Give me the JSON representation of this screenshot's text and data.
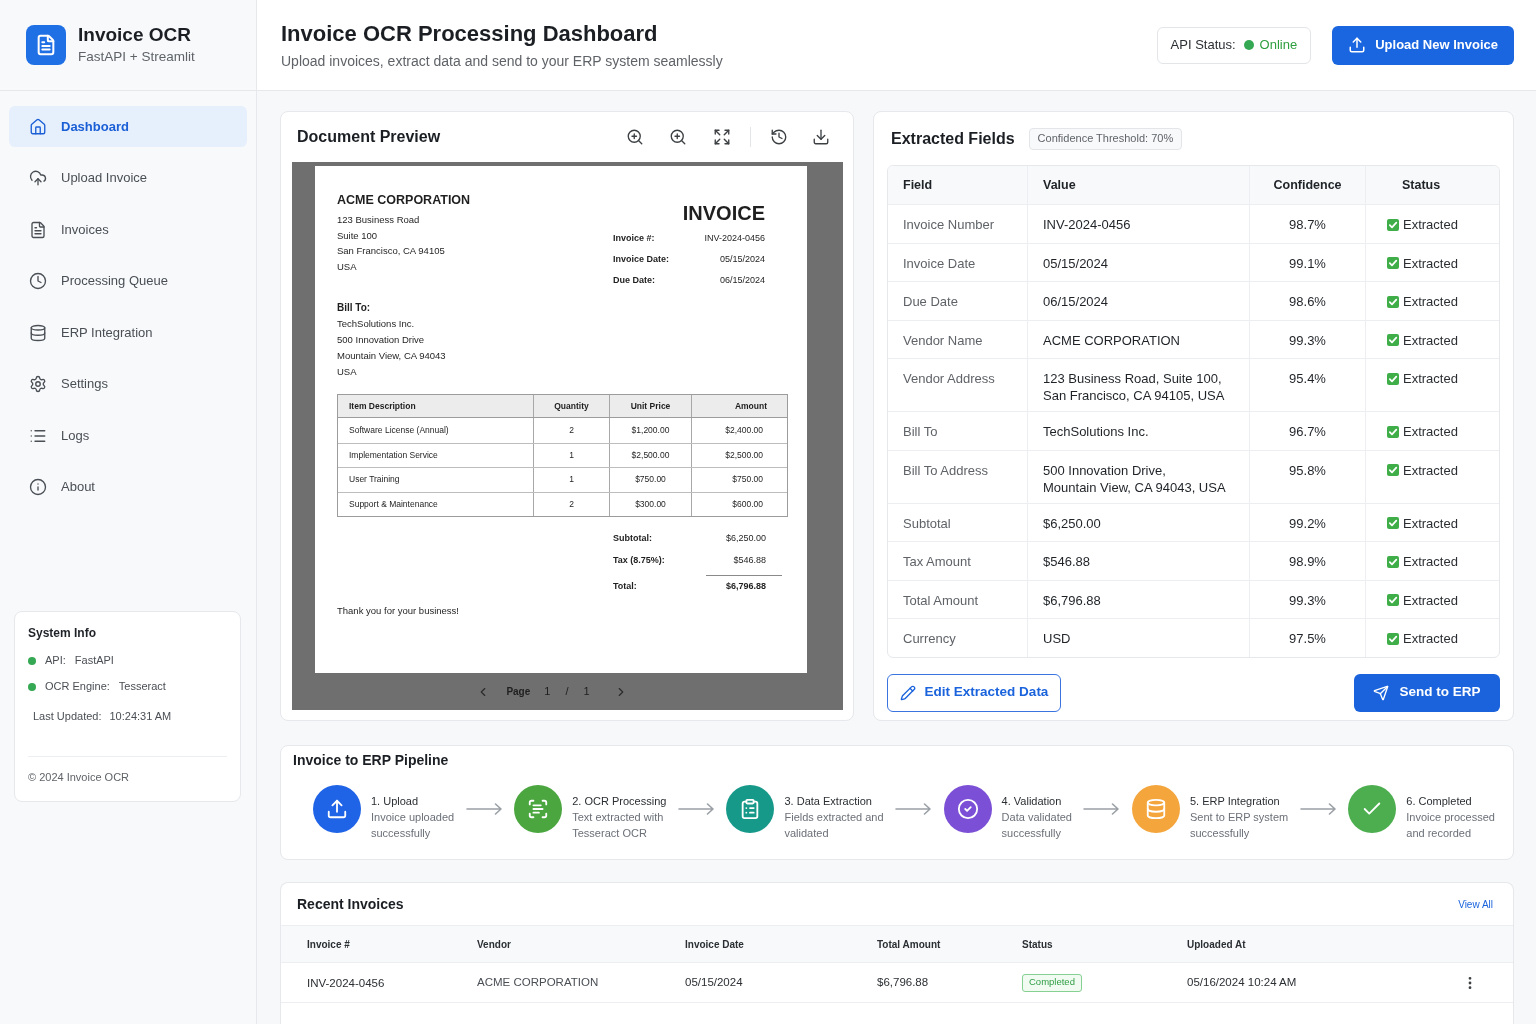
{
  "brand": {
    "title": "Invoice OCR",
    "subtitle": "FastAPI + Streamlit"
  },
  "sidebar": {
    "items": [
      {
        "label": "Dashboard",
        "selected": true
      },
      {
        "label": "Upload Invoice",
        "selected": false
      },
      {
        "label": "Invoices",
        "selected": false
      },
      {
        "label": "Processing Queue",
        "selected": false
      },
      {
        "label": "ERP Integration",
        "selected": false
      },
      {
        "label": "Settings",
        "selected": false
      },
      {
        "label": "Logs",
        "selected": false
      },
      {
        "label": "About",
        "selected": false
      }
    ],
    "system_info": {
      "title": "System Info",
      "items": [
        {
          "label": "API:",
          "value": "FastAPI",
          "online": true
        },
        {
          "label": "OCR Engine:",
          "value": "Tesseract",
          "online": true
        }
      ],
      "last_updated": {
        "label": "Last Updated:",
        "value": "10:24:31 AM"
      },
      "footer": "© 2024 Invoice OCR"
    }
  },
  "header": {
    "title": "Invoice OCR Processing Dashboard",
    "subtitle": "Upload invoices, extract data and send to your ERP system seamlessly",
    "api_status": {
      "label": "API Status:",
      "value": "Online",
      "online": true
    },
    "upload_button": "Upload New Invoice"
  },
  "document_preview": {
    "title": "Document Preview",
    "page": {
      "vendor": {
        "name": "ACME CORPORATION",
        "address": [
          "123 Business Road",
          "Suite 100",
          "San Francisco, CA 94105",
          "USA"
        ]
      },
      "heading": "INVOICE",
      "meta": [
        {
          "label": "Invoice #:",
          "value": "INV-2024-0456"
        },
        {
          "label": "Invoice Date:",
          "value": "05/15/2024"
        },
        {
          "label": "Due Date:",
          "value": "06/15/2024"
        }
      ],
      "bill_to": {
        "label": "Bill To:",
        "lines": [
          "TechSolutions Inc.",
          "500 Innovation Drive",
          "Mountain View, CA 94043",
          "USA"
        ]
      },
      "items_table": {
        "columns": [
          "Item Description",
          "Quantity",
          "Unit Price",
          "Amount"
        ],
        "rows": [
          [
            "Software License (Annual)",
            "2",
            "$1,200.00",
            "$2,400.00"
          ],
          [
            "Implementation Service",
            "1",
            "$2,500.00",
            "$2,500.00"
          ],
          [
            "User Training",
            "1",
            "$750.00",
            "$750.00"
          ],
          [
            "Support & Maintenance",
            "2",
            "$300.00",
            "$600.00"
          ]
        ]
      },
      "totals": [
        {
          "kind": "line",
          "label": "Subtotal:",
          "value": "$6,250.00"
        },
        {
          "kind": "line",
          "label": "Tax (8.75%):",
          "value": "$546.88"
        },
        {
          "kind": "total",
          "label": "Total:",
          "value": "$6,796.88"
        }
      ],
      "note": "Thank you for your business!"
    },
    "pager": {
      "label": "Page",
      "current": "1",
      "separator": "/",
      "total": "1"
    }
  },
  "extracted_fields": {
    "title": "Extracted Fields",
    "threshold_badge": "Confidence Threshold: 70%",
    "columns": [
      "Field",
      "Value",
      "Confidence",
      "Status"
    ],
    "rows": [
      {
        "field": "Invoice Number",
        "value": [
          "INV-2024-0456"
        ],
        "confidence": "98.7%",
        "status": "Extracted",
        "checked": true
      },
      {
        "field": "Invoice Date",
        "value": [
          "05/15/2024"
        ],
        "confidence": "99.1%",
        "status": "Extracted",
        "checked": true
      },
      {
        "field": "Due Date",
        "value": [
          "06/15/2024"
        ],
        "confidence": "98.6%",
        "status": "Extracted",
        "checked": true
      },
      {
        "field": "Vendor Name",
        "value": [
          "ACME CORPORATION"
        ],
        "confidence": "99.3%",
        "status": "Extracted",
        "checked": true
      },
      {
        "field": "Vendor Address",
        "value": [
          "123 Business Road, Suite 100,",
          "San Francisco, CA 94105, USA"
        ],
        "confidence": "95.4%",
        "status": "Extracted",
        "checked": true
      },
      {
        "field": "Bill To",
        "value": [
          "TechSolutions Inc."
        ],
        "confidence": "96.7%",
        "status": "Extracted",
        "checked": true
      },
      {
        "field": "Bill To Address",
        "value": [
          "500 Innovation Drive,",
          "Mountain View, CA 94043, USA"
        ],
        "confidence": "95.8%",
        "status": "Extracted",
        "checked": true
      },
      {
        "field": "Subtotal",
        "value": [
          "$6,250.00"
        ],
        "confidence": "99.2%",
        "status": "Extracted",
        "checked": true
      },
      {
        "field": "Tax Amount",
        "value": [
          "$546.88"
        ],
        "confidence": "98.9%",
        "status": "Extracted",
        "checked": true
      },
      {
        "field": "Total Amount",
        "value": [
          "$6,796.88"
        ],
        "confidence": "99.3%",
        "status": "Extracted",
        "checked": true
      },
      {
        "field": "Currency",
        "value": [
          "USD"
        ],
        "confidence": "97.5%",
        "status": "Extracted",
        "checked": true
      }
    ],
    "edit_button": "Edit Extracted Data",
    "send_button": "Send to ERP"
  },
  "pipeline": {
    "title": "Invoice to ERP Pipeline",
    "steps": [
      {
        "title": "1. Upload",
        "description": [
          "Invoice uploaded",
          "successfully"
        ],
        "color": "#1f63e6"
      },
      {
        "title": "2. OCR Processing",
        "description": [
          "Text extracted with",
          "Tesseract OCR"
        ],
        "color": "#4ba640"
      },
      {
        "title": "3. Data Extraction",
        "description": [
          "Fields extracted and",
          "validated"
        ],
        "color": "#17998a"
      },
      {
        "title": "4. Validation",
        "description": [
          "Data validated",
          "successfully"
        ],
        "color": "#7b4fd6"
      },
      {
        "title": "5. ERP Integration",
        "description": [
          "Sent to ERP system",
          "successfully"
        ],
        "color": "#f4a53c"
      },
      {
        "title": "6. Completed",
        "description": [
          "Invoice processed",
          "and recorded"
        ],
        "color": "#4cae4f"
      }
    ]
  },
  "recent_invoices": {
    "title": "Recent Invoices",
    "view_all": "View All",
    "columns": [
      "Invoice #",
      "Vendor",
      "Invoice Date",
      "Total Amount",
      "Status",
      "Uploaded At"
    ],
    "rows": [
      {
        "invoice": "INV-2024-0456",
        "vendor": "ACME CORPORATION",
        "date": "05/15/2024",
        "total": "$6,796.88",
        "status": "Completed",
        "uploaded_at": "05/16/2024 10:24 AM"
      }
    ]
  }
}
